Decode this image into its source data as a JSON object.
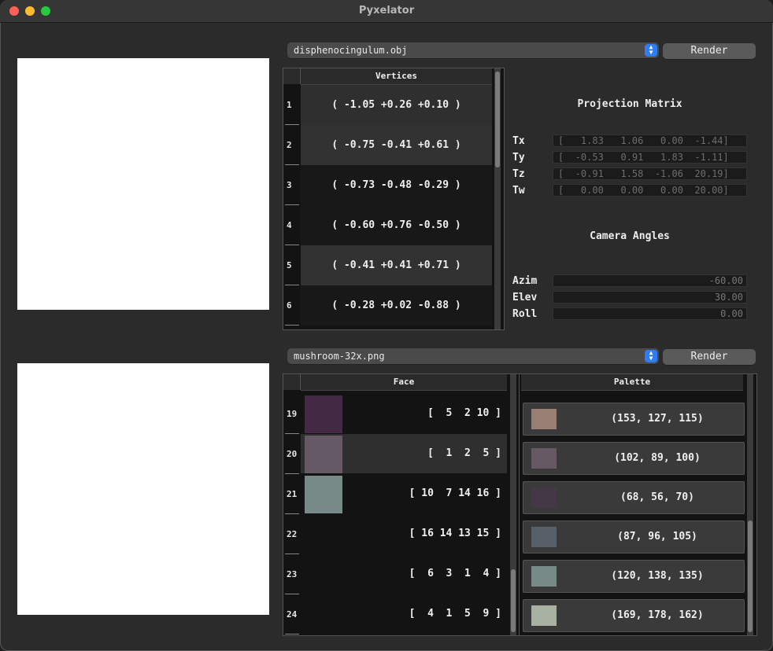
{
  "window": {
    "title": "Pyxelator"
  },
  "model": {
    "file": "disphenocingulum.obj",
    "render_label": "Render",
    "vertices_header": "Vertices",
    "vertices": [
      {
        "index": "1",
        "coords": "( -1.05 +0.26 +0.10 )"
      },
      {
        "index": "2",
        "coords": "( -0.75 -0.41 +0.61 )"
      },
      {
        "index": "3",
        "coords": "( -0.73 -0.48 -0.29 )"
      },
      {
        "index": "4",
        "coords": "( -0.60 +0.76 -0.50 )"
      },
      {
        "index": "5",
        "coords": "( -0.41 +0.41 +0.71 )"
      },
      {
        "index": "6",
        "coords": "( -0.28 +0.02 -0.88 )"
      }
    ]
  },
  "projection": {
    "title": "Projection Matrix",
    "rows": [
      {
        "label": "Tx",
        "values": "[   1.83   1.06   0.00  -1.44]"
      },
      {
        "label": "Ty",
        "values": "[  -0.53   0.91   1.83  -1.11]"
      },
      {
        "label": "Tz",
        "values": "[  -0.91   1.58  -1.06  20.19]"
      },
      {
        "label": "Tw",
        "values": "[   0.00   0.00   0.00  20.00]"
      }
    ]
  },
  "camera": {
    "title": "Camera Angles",
    "azim_label": "Azim",
    "azim": "-60.00",
    "elev_label": "Elev",
    "elev": "30.00",
    "roll_label": "Roll",
    "roll": "0.00"
  },
  "texture": {
    "file": "mushroom-32x.png",
    "render_label": "Render",
    "face_header": "Face",
    "palette_header": "Palette",
    "faces": [
      {
        "index": "19",
        "indices": "[  5  2 10 ]",
        "color": "#442a44"
      },
      {
        "index": "20",
        "indices": "[  1  2  5 ]",
        "color": "#665966"
      },
      {
        "index": "21",
        "indices": "[ 10  7 14 16 ]",
        "color": "#788a87"
      },
      {
        "index": "22",
        "indices": "[ 16 14 13 15 ]",
        "color": ""
      },
      {
        "index": "23",
        "indices": "[  6  3  1  4 ]",
        "color": ""
      },
      {
        "index": "24",
        "indices": "[  4  1  5  9 ]",
        "color": ""
      }
    ],
    "palette": [
      {
        "rgb": "(153, 127, 115)",
        "color": "#997f73"
      },
      {
        "rgb": "(102, 89, 100)",
        "color": "#665964"
      },
      {
        "rgb": "(68, 56, 70)",
        "color": "#443846"
      },
      {
        "rgb": "(87, 96, 105)",
        "color": "#576069"
      },
      {
        "rgb": "(120, 138, 135)",
        "color": "#788a87"
      },
      {
        "rgb": "(169, 178, 162)",
        "color": "#a9b2a2"
      }
    ]
  }
}
